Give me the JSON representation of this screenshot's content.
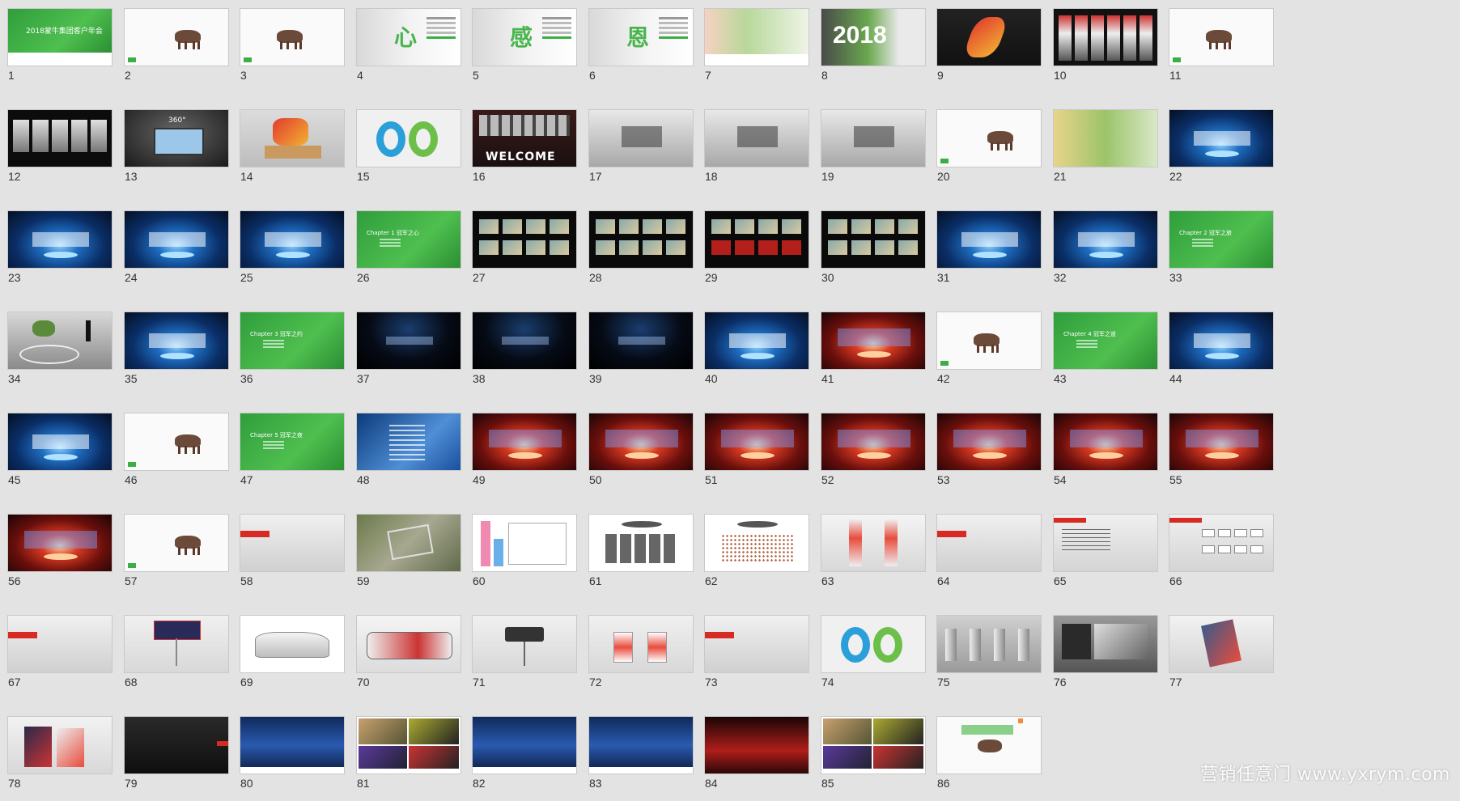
{
  "colors": {
    "background": "#e3e3e3",
    "green": "#3bae45",
    "red": "#d72a23",
    "dark": "#111111",
    "blue_stage": "#0b3f86"
  },
  "watermark": "营销任意门 www.yxrym.com",
  "slides": [
    {
      "num": "1",
      "style": "green-title",
      "caption": "2018蒙牛集团客户年会"
    },
    {
      "num": "2",
      "style": "white-cow"
    },
    {
      "num": "3",
      "style": "white-cow-small"
    },
    {
      "num": "4",
      "style": "white-char",
      "caption": "心"
    },
    {
      "num": "5",
      "style": "white-char",
      "caption": "感"
    },
    {
      "num": "6",
      "style": "white-char",
      "caption": "恩"
    },
    {
      "num": "7",
      "style": "white-photo"
    },
    {
      "num": "8",
      "style": "year",
      "caption": "2018"
    },
    {
      "num": "9",
      "style": "runner"
    },
    {
      "num": "10",
      "style": "strip-dark"
    },
    {
      "num": "11",
      "style": "white-cow-small"
    },
    {
      "num": "12",
      "style": "dark-screens"
    },
    {
      "num": "13",
      "style": "dark-360",
      "caption": "360°"
    },
    {
      "num": "14",
      "style": "gray-room-runner"
    },
    {
      "num": "15",
      "style": "bands"
    },
    {
      "num": "16",
      "style": "welcome",
      "caption": "WELCOME"
    },
    {
      "num": "17",
      "style": "gray-room"
    },
    {
      "num": "18",
      "style": "gray-room"
    },
    {
      "num": "19",
      "style": "gray-room"
    },
    {
      "num": "20",
      "style": "white-cow"
    },
    {
      "num": "21",
      "style": "green-field"
    },
    {
      "num": "22",
      "style": "blue-stage"
    },
    {
      "num": "23",
      "style": "blue-stage"
    },
    {
      "num": "24",
      "style": "blue-stage"
    },
    {
      "num": "25",
      "style": "blue-stage"
    },
    {
      "num": "26",
      "style": "green-chapter",
      "caption": "Chapter 1  冠军之心"
    },
    {
      "num": "27",
      "style": "dark-gallery"
    },
    {
      "num": "28",
      "style": "dark-gallery"
    },
    {
      "num": "29",
      "style": "dark-gallery-red"
    },
    {
      "num": "30",
      "style": "dark-gallery"
    },
    {
      "num": "31",
      "style": "blue-stage"
    },
    {
      "num": "32",
      "style": "blue-stage"
    },
    {
      "num": "33",
      "style": "green-chapter",
      "caption": "Chapter 2  冠军之旅"
    },
    {
      "num": "34",
      "style": "gray-podium"
    },
    {
      "num": "35",
      "style": "blue-stage"
    },
    {
      "num": "36",
      "style": "green-chapter",
      "caption": "Chapter 3  冠军之约"
    },
    {
      "num": "37",
      "style": "dark-lights"
    },
    {
      "num": "38",
      "style": "dark-lights"
    },
    {
      "num": "39",
      "style": "dark-lights"
    },
    {
      "num": "40",
      "style": "blue-stage"
    },
    {
      "num": "41",
      "style": "red-stage"
    },
    {
      "num": "42",
      "style": "white-cow-small"
    },
    {
      "num": "43",
      "style": "green-chapter",
      "caption": "Chapter 4  冠军之道"
    },
    {
      "num": "44",
      "style": "blue-stage"
    },
    {
      "num": "45",
      "style": "blue-stage"
    },
    {
      "num": "46",
      "style": "white-cow"
    },
    {
      "num": "47",
      "style": "green-chapter",
      "caption": "Chapter 5  冠军之夜"
    },
    {
      "num": "48",
      "style": "blue-menu"
    },
    {
      "num": "49",
      "style": "red-stage"
    },
    {
      "num": "50",
      "style": "red-stage"
    },
    {
      "num": "51",
      "style": "red-stage"
    },
    {
      "num": "52",
      "style": "red-stage"
    },
    {
      "num": "53",
      "style": "red-stage"
    },
    {
      "num": "54",
      "style": "red-stage"
    },
    {
      "num": "55",
      "style": "red-stage"
    },
    {
      "num": "56",
      "style": "red-stage"
    },
    {
      "num": "57",
      "style": "white-cow"
    },
    {
      "num": "58",
      "style": "gray-label"
    },
    {
      "num": "59",
      "style": "aerial"
    },
    {
      "num": "60",
      "style": "floorplan"
    },
    {
      "num": "61",
      "style": "seating"
    },
    {
      "num": "62",
      "style": "seating-dots"
    },
    {
      "num": "63",
      "style": "standees"
    },
    {
      "num": "64",
      "style": "gray-label"
    },
    {
      "num": "65",
      "style": "gray-text"
    },
    {
      "num": "66",
      "style": "gray-flow"
    },
    {
      "num": "67",
      "style": "gray-label"
    },
    {
      "num": "68",
      "style": "sign-board"
    },
    {
      "num": "69",
      "style": "van"
    },
    {
      "num": "70",
      "style": "bus"
    },
    {
      "num": "71",
      "style": "sign-post"
    },
    {
      "num": "72",
      "style": "badges"
    },
    {
      "num": "73",
      "style": "gray-label"
    },
    {
      "num": "74",
      "style": "bands"
    },
    {
      "num": "75",
      "style": "gates"
    },
    {
      "num": "76",
      "style": "gray-photo"
    },
    {
      "num": "77",
      "style": "booklet"
    },
    {
      "num": "78",
      "style": "bag"
    },
    {
      "num": "79",
      "style": "dark-plain"
    },
    {
      "num": "80",
      "style": "blue-photo"
    },
    {
      "num": "81",
      "style": "mixed-photos"
    },
    {
      "num": "82",
      "style": "blue-photo"
    },
    {
      "num": "83",
      "style": "blue-photo"
    },
    {
      "num": "84",
      "style": "red-photo"
    },
    {
      "num": "85",
      "style": "mixed-photos"
    },
    {
      "num": "86",
      "style": "end-green"
    }
  ]
}
